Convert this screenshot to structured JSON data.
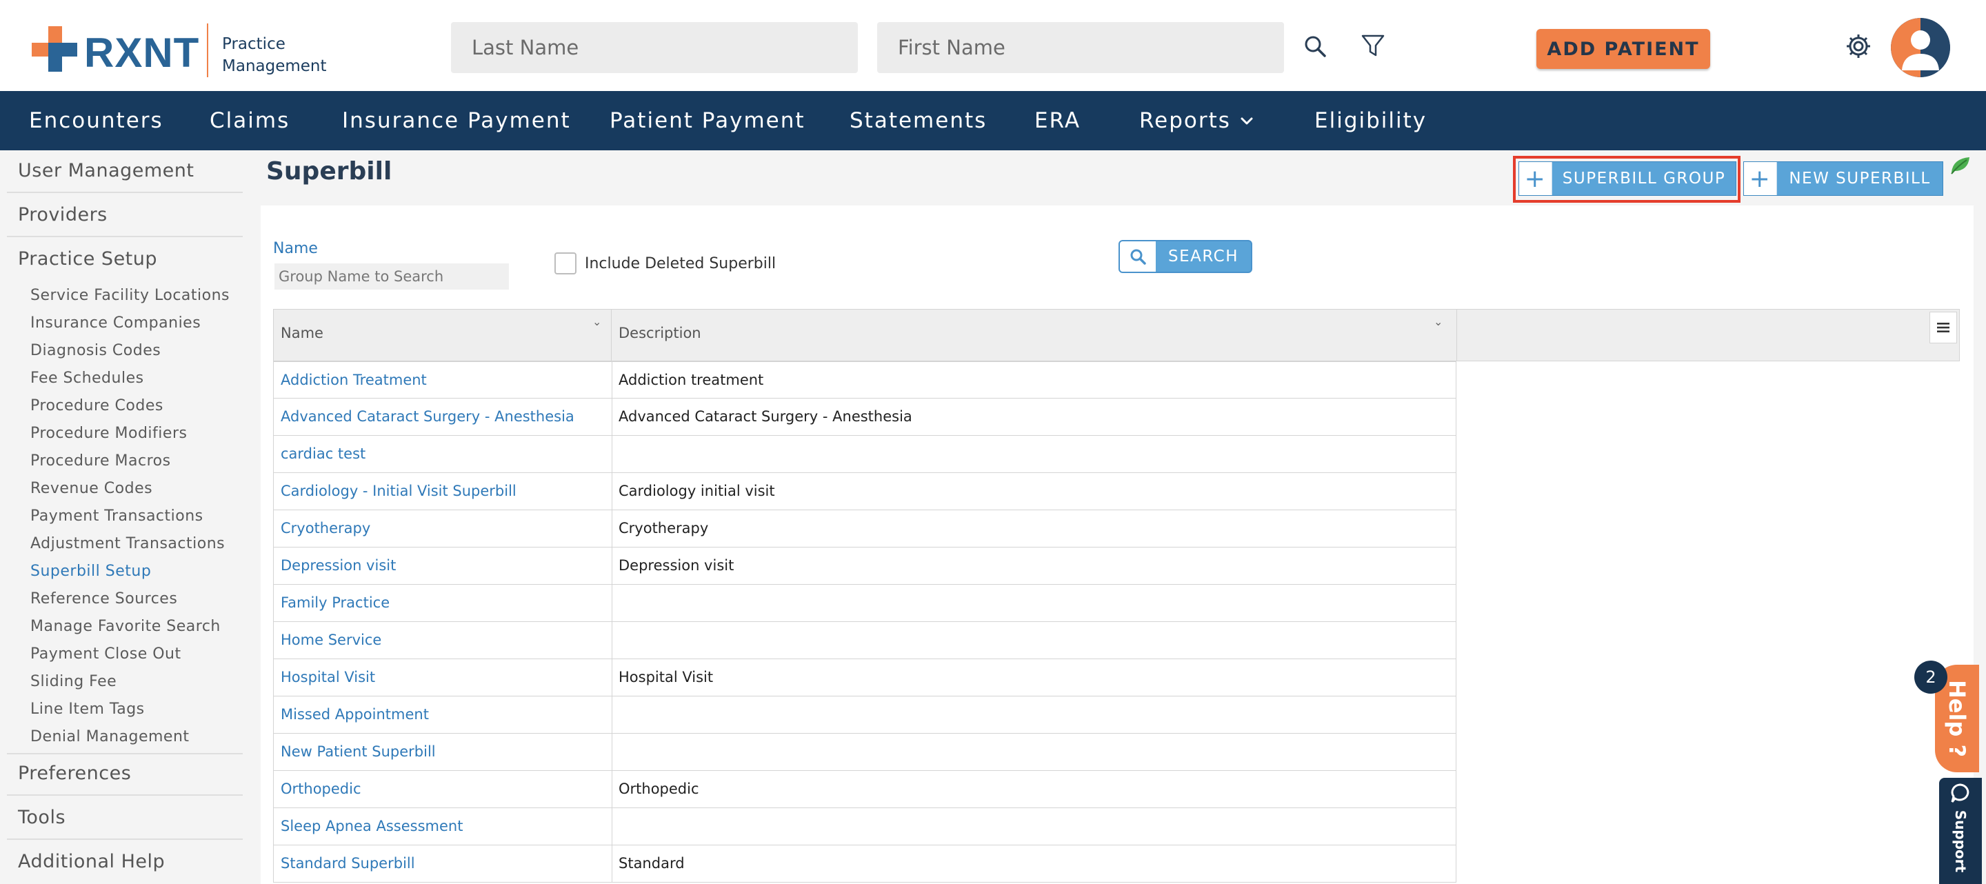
{
  "header": {
    "brand": "RXNT",
    "product_line1": "Practice",
    "product_line2": "Management",
    "last_name_placeholder": "Last Name",
    "first_name_placeholder": "First Name",
    "add_patient_label": "ADD PATIENT"
  },
  "nav": {
    "items": [
      {
        "label": "Encounters"
      },
      {
        "label": "Claims"
      },
      {
        "label": "Insurance Payment"
      },
      {
        "label": "Patient Payment"
      },
      {
        "label": "Statements"
      },
      {
        "label": "ERA"
      },
      {
        "label": "Reports"
      },
      {
        "label": "Eligibility"
      }
    ]
  },
  "sidebar": {
    "sections": [
      {
        "label": "User Management"
      },
      {
        "label": "Providers"
      },
      {
        "label": "Practice Setup"
      },
      {
        "label": "Preferences"
      },
      {
        "label": "Tools"
      },
      {
        "label": "Additional Help"
      }
    ],
    "practice_setup_items": [
      {
        "label": "Service Facility Locations"
      },
      {
        "label": "Insurance Companies"
      },
      {
        "label": "Diagnosis Codes"
      },
      {
        "label": "Fee Schedules"
      },
      {
        "label": "Procedure Codes"
      },
      {
        "label": "Procedure Modifiers"
      },
      {
        "label": "Procedure Macros"
      },
      {
        "label": "Revenue Codes"
      },
      {
        "label": "Payment Transactions"
      },
      {
        "label": "Adjustment Transactions"
      },
      {
        "label": "Superbill Setup"
      },
      {
        "label": "Reference Sources"
      },
      {
        "label": "Manage Favorite Search"
      },
      {
        "label": "Payment Close Out"
      },
      {
        "label": "Sliding Fee"
      },
      {
        "label": "Line Item Tags"
      },
      {
        "label": "Denial Management"
      }
    ],
    "active_item": "Superbill Setup"
  },
  "main": {
    "title": "Superbill",
    "superbill_group_label": "SUPERBILL GROUP",
    "new_superbill_label": "NEW SUPERBILL",
    "filter": {
      "name_label": "Name",
      "name_placeholder": "Group Name to Search",
      "name_value": "",
      "include_deleted_label": "Include Deleted Superbill",
      "include_deleted_checked": false,
      "search_label": "SEARCH"
    },
    "table": {
      "columns": [
        "Name",
        "Description"
      ],
      "rows": [
        {
          "name": "Addiction Treatment",
          "description": "Addiction treatment"
        },
        {
          "name": "Advanced Cataract Surgery - Anesthesia",
          "description": "Advanced Cataract Surgery - Anesthesia"
        },
        {
          "name": "cardiac test",
          "description": ""
        },
        {
          "name": "Cardiology - Initial Visit Superbill",
          "description": "Cardiology initial visit"
        },
        {
          "name": "Cryotherapy",
          "description": "Cryotherapy"
        },
        {
          "name": "Depression visit",
          "description": "Depression visit"
        },
        {
          "name": "Family Practice",
          "description": ""
        },
        {
          "name": "Home Service",
          "description": ""
        },
        {
          "name": "Hospital Visit",
          "description": "Hospital Visit"
        },
        {
          "name": "Missed Appointment",
          "description": ""
        },
        {
          "name": "New Patient Superbill",
          "description": ""
        },
        {
          "name": "Orthopedic",
          "description": "Orthopedic"
        },
        {
          "name": "Sleep Apnea Assessment",
          "description": ""
        },
        {
          "name": "Standard Superbill",
          "description": "Standard"
        }
      ]
    }
  },
  "widgets": {
    "help_label": "Help ?",
    "help_badge": "2",
    "support_label": "Support"
  },
  "colors": {
    "brand_blue": "#2a6496",
    "brand_orange": "#f08148",
    "nav_bg": "#173a5e",
    "link_blue": "#2f79b8",
    "button_blue": "#5aa4d8",
    "highlight_red": "#e53d2c"
  },
  "icons": [
    "search-icon",
    "filter-icon",
    "gear-icon",
    "user-avatar-icon",
    "chevron-down-icon",
    "plus-icon",
    "column-menu-icon",
    "leaf-icon",
    "chat-icon"
  ]
}
